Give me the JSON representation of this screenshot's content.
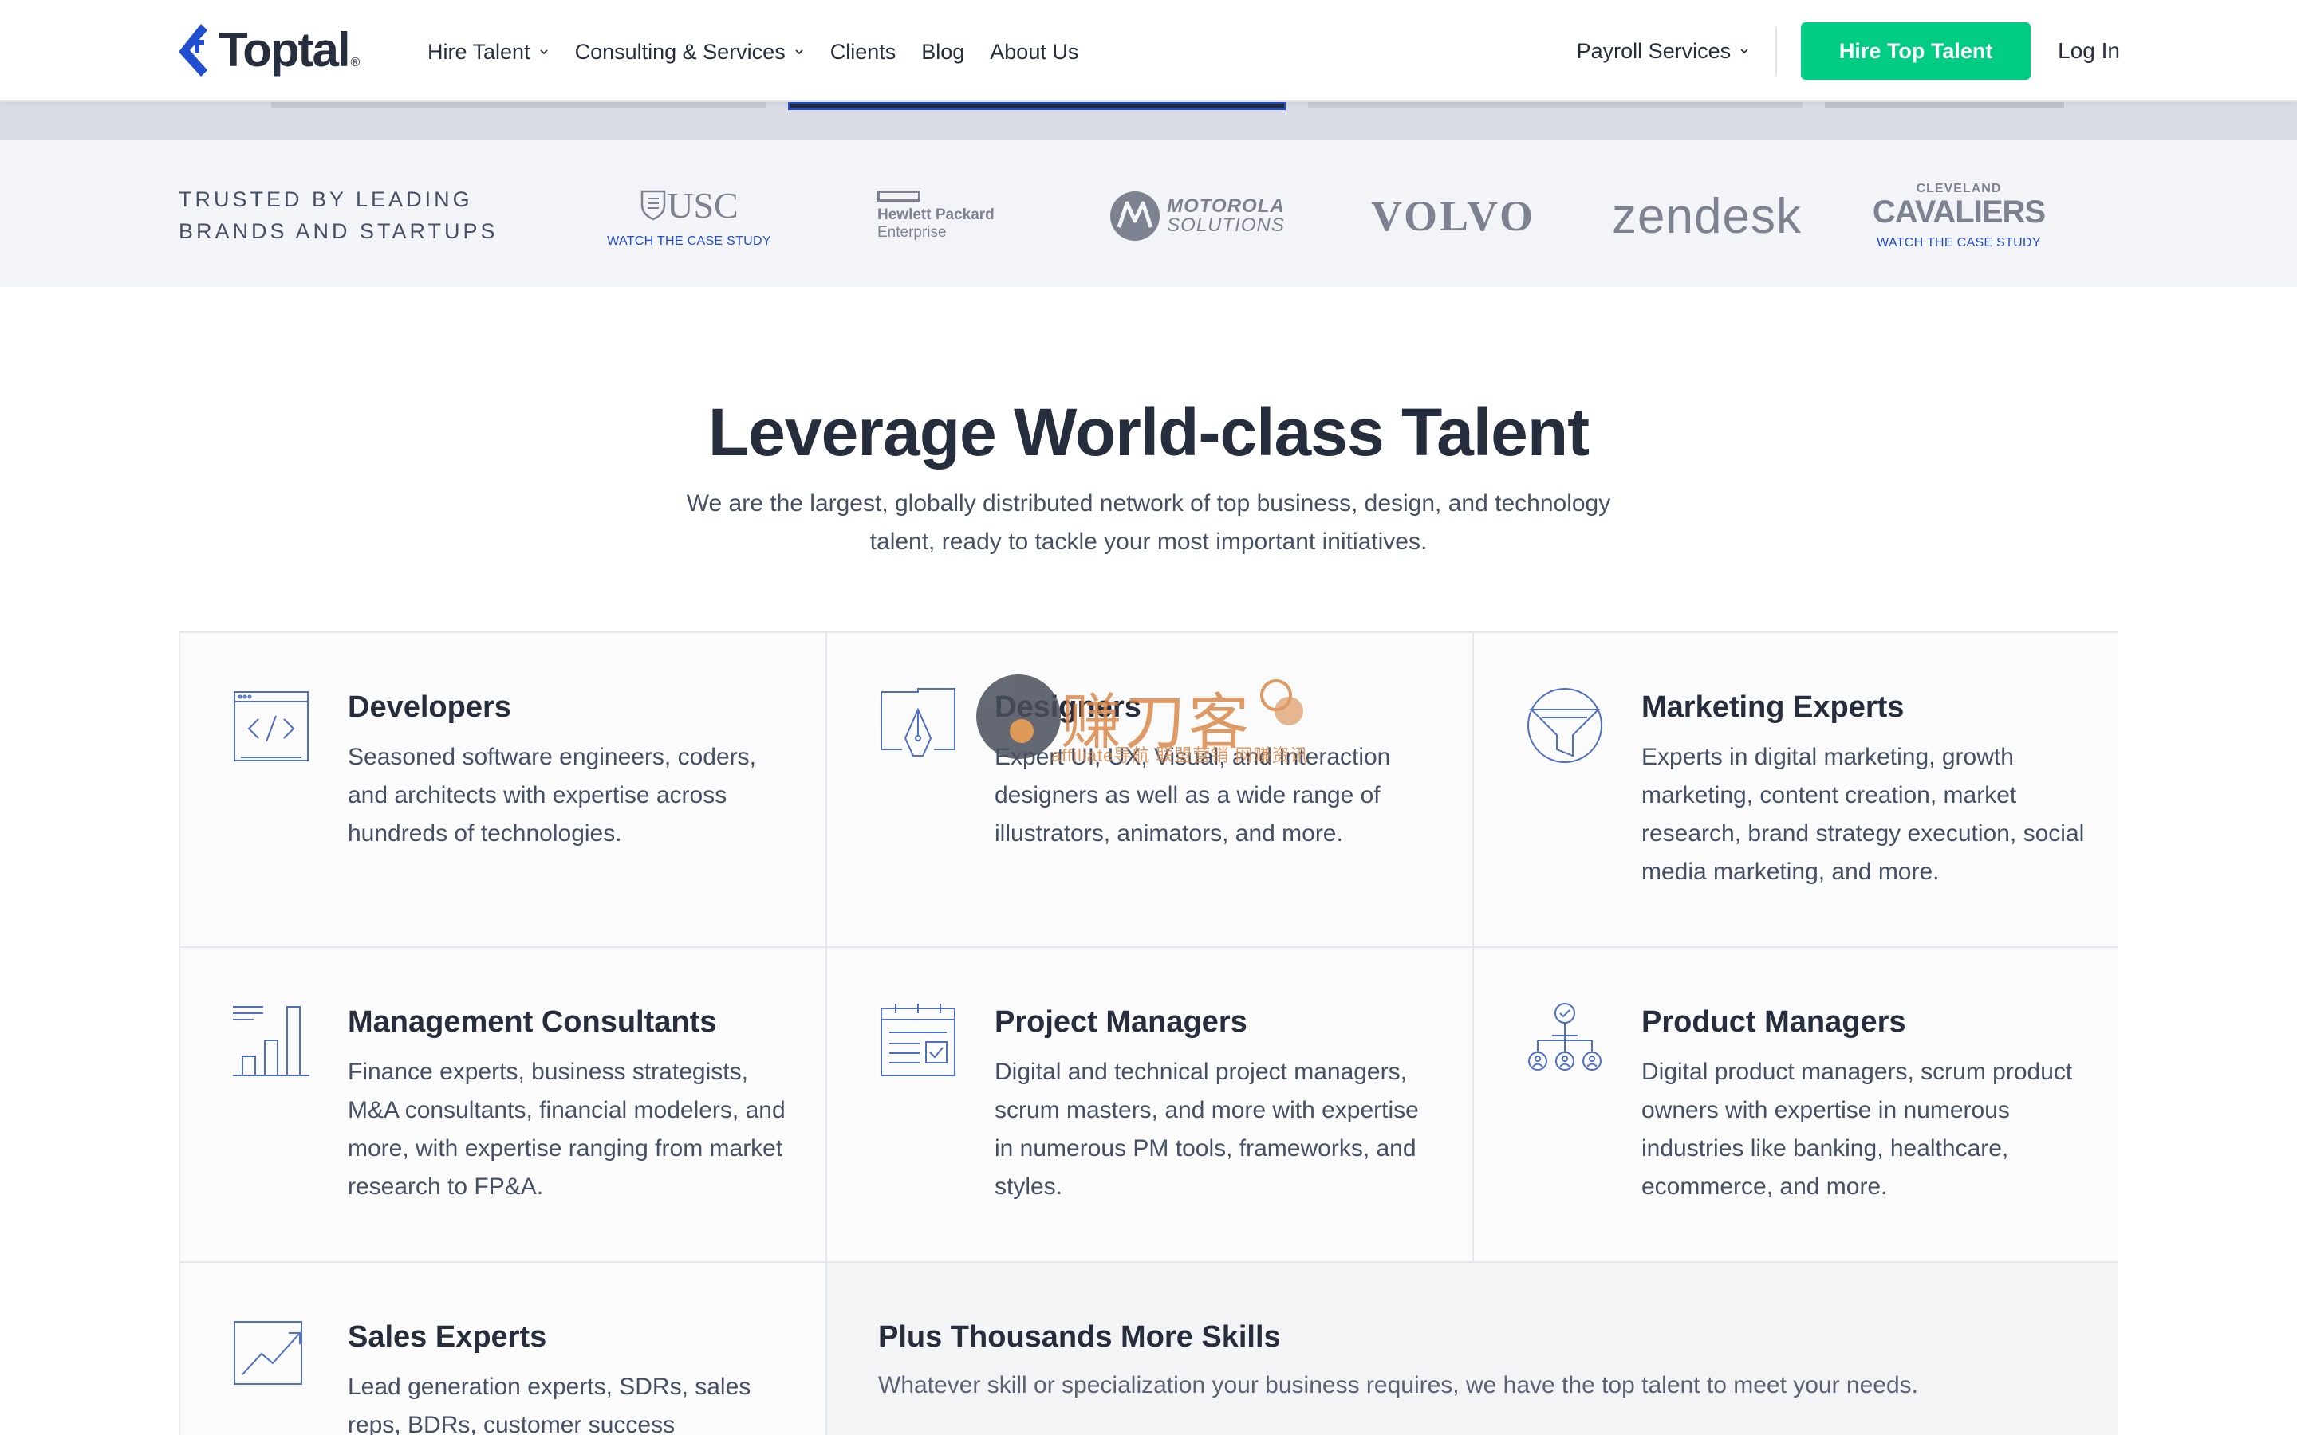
{
  "header": {
    "logo_text": "Toptal",
    "logo_reg": "®",
    "nav": [
      {
        "label": "Hire Talent",
        "dropdown": true
      },
      {
        "label": "Consulting & Services",
        "dropdown": true
      },
      {
        "label": "Clients",
        "dropdown": false
      },
      {
        "label": "Blog",
        "dropdown": false
      },
      {
        "label": "About Us",
        "dropdown": false
      }
    ],
    "payroll_label": "Payroll Services",
    "cta_label": "Hire Top Talent",
    "login_label": "Log In"
  },
  "trusted": {
    "title": "TRUSTED BY LEADING\nBRANDS AND STARTUPS",
    "brands": {
      "usc": {
        "name": "USC",
        "caption": "WATCH THE CASE STUDY"
      },
      "hpe": {
        "line1": "Hewlett Packard",
        "line2": "Enterprise"
      },
      "motorola": {
        "line1": "MOTOROLA",
        "line2": "SOLUTIONS"
      },
      "volvo": {
        "name": "VOLVO"
      },
      "zendesk": {
        "name": "zendesk"
      },
      "cavaliers": {
        "top": "CLEVELAND",
        "name": "CAVALIERS",
        "caption": "WATCH THE CASE STUDY"
      }
    }
  },
  "section": {
    "title": "Leverage World-class Talent",
    "subtitle": "We are the largest, globally distributed network of top business, design, and technology talent, ready to tackle your most important initiatives."
  },
  "categories": [
    {
      "title": "Developers",
      "desc": "Seasoned software engineers, coders, and architects with expertise across hundreds of technologies.",
      "icon": "code-window-icon"
    },
    {
      "title": "Designers",
      "desc": "Expert UI, UX, Visual, and Interaction designers as well as a wide range of illustrators, animators, and more.",
      "icon": "pen-nib-icon"
    },
    {
      "title": "Marketing Experts",
      "desc": "Experts in digital marketing, growth marketing, content creation, market research, brand strategy execution, social media marketing, and more.",
      "icon": "funnel-icon"
    },
    {
      "title": "Management Consultants",
      "desc": "Finance experts, business strategists, M&A consultants, financial modelers, and more, with expertise ranging from market research to FP&A.",
      "icon": "bar-chart-icon"
    },
    {
      "title": "Project Managers",
      "desc": "Digital and technical project managers, scrum masters, and more with expertise in numerous PM tools, frameworks, and styles.",
      "icon": "calendar-check-icon"
    },
    {
      "title": "Product Managers",
      "desc": "Digital product managers, scrum product owners with expertise in numerous industries like banking, healthcare, ecommerce, and more.",
      "icon": "org-chart-icon"
    },
    {
      "title": "Sales Experts",
      "desc": "Lead generation experts, SDRs, sales reps, BDRs, customer success",
      "icon": "trend-up-icon"
    }
  ],
  "more": {
    "title": "Plus Thousands More Skills",
    "desc": "Whatever skill or specialization your business requires, we have the top talent to meet your needs."
  },
  "watermark": {
    "text": "赚刀客",
    "tag": "affiliate导航 联盟营销 网赚资讯"
  },
  "colors": {
    "accent_blue": "#204ecf",
    "cta_green": "#00cc83",
    "text_dark": "#262d3d",
    "icon_stroke": "#4f6fc4"
  }
}
